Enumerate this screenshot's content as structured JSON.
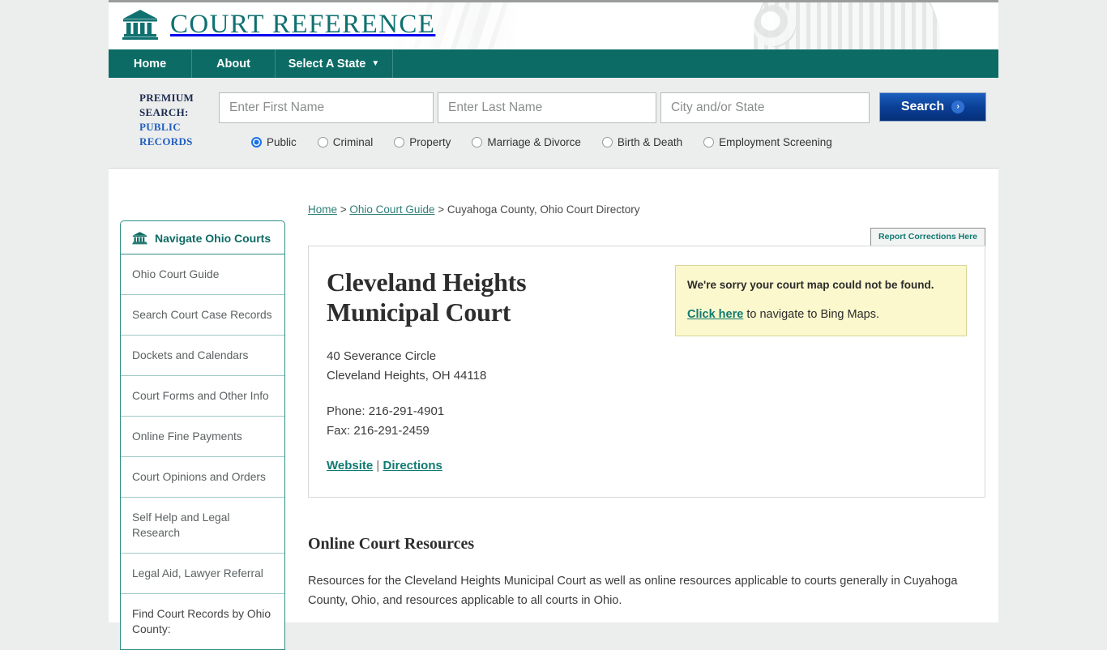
{
  "brand": {
    "name": "COURT REFERENCE",
    "logo_icon": "courthouse-icon"
  },
  "nav": {
    "items": [
      {
        "label": "Home"
      },
      {
        "label": "About"
      },
      {
        "label": "Select A State",
        "caret": "▼"
      }
    ]
  },
  "premium_search": {
    "label_line1": "PREMIUM",
    "label_line2": "SEARCH:",
    "label_line3": "PUBLIC",
    "label_line4": "RECORDS",
    "first_name_placeholder": "Enter First Name",
    "first_name_value": "",
    "last_name_placeholder": "Enter Last Name",
    "last_name_value": "",
    "city_state_placeholder": "City and/or State",
    "city_state_value": "",
    "search_button": "Search",
    "search_chevron": "›",
    "options": [
      {
        "label": "Public",
        "selected": true
      },
      {
        "label": "Criminal",
        "selected": false
      },
      {
        "label": "Property",
        "selected": false
      },
      {
        "label": "Marriage & Divorce",
        "selected": false
      },
      {
        "label": "Birth & Death",
        "selected": false
      },
      {
        "label": "Employment Screening",
        "selected": false
      }
    ]
  },
  "breadcrumb": {
    "home": "Home",
    "sep1": " > ",
    "guide": "Ohio Court Guide",
    "sep2": " > ",
    "current": "Cuyahoga County, Ohio Court Directory"
  },
  "report_corrections_button": "Report Corrections Here",
  "sidebar": {
    "header": "Navigate Ohio Courts",
    "header_icon": "courthouse-icon",
    "items": [
      {
        "label": "Ohio Court Guide"
      },
      {
        "label": "Search Court Case Records"
      },
      {
        "label": "Dockets and Calendars"
      },
      {
        "label": "Court Forms and Other Info"
      },
      {
        "label": "Online Fine Payments"
      },
      {
        "label": "Court Opinions and Orders"
      },
      {
        "label": "Self Help and Legal Research"
      },
      {
        "label": "Legal Aid, Lawyer Referral"
      },
      {
        "label": "Find Court Records by Ohio County:"
      }
    ]
  },
  "court": {
    "title": "Cleveland Heights Municipal Court",
    "address_line1": "40 Severance Circle",
    "address_line2": "Cleveland Heights, OH 44118",
    "phone": "Phone: 216-291-4901",
    "fax": "Fax: 216-291-2459",
    "website_link": "Website",
    "link_separator": " | ",
    "directions_link": "Directions"
  },
  "map_notice": {
    "title": "We're sorry your court map could not be found.",
    "link": "Click here",
    "body_rest": " to navigate to Bing Maps."
  },
  "resources": {
    "title": "Online Court Resources",
    "body": "Resources for the Cleveland Heights Municipal Court as well as online resources applicable to courts generally in Cuyahoga County, Ohio, and resources applicable to all courts in Ohio."
  },
  "colors": {
    "brand_teal": "#0f7070",
    "nav_teal": "#0c6b65",
    "link_teal": "#0f7a72",
    "notice_yellow": "#fbf8cd",
    "search_blue": "#0a3f96"
  }
}
